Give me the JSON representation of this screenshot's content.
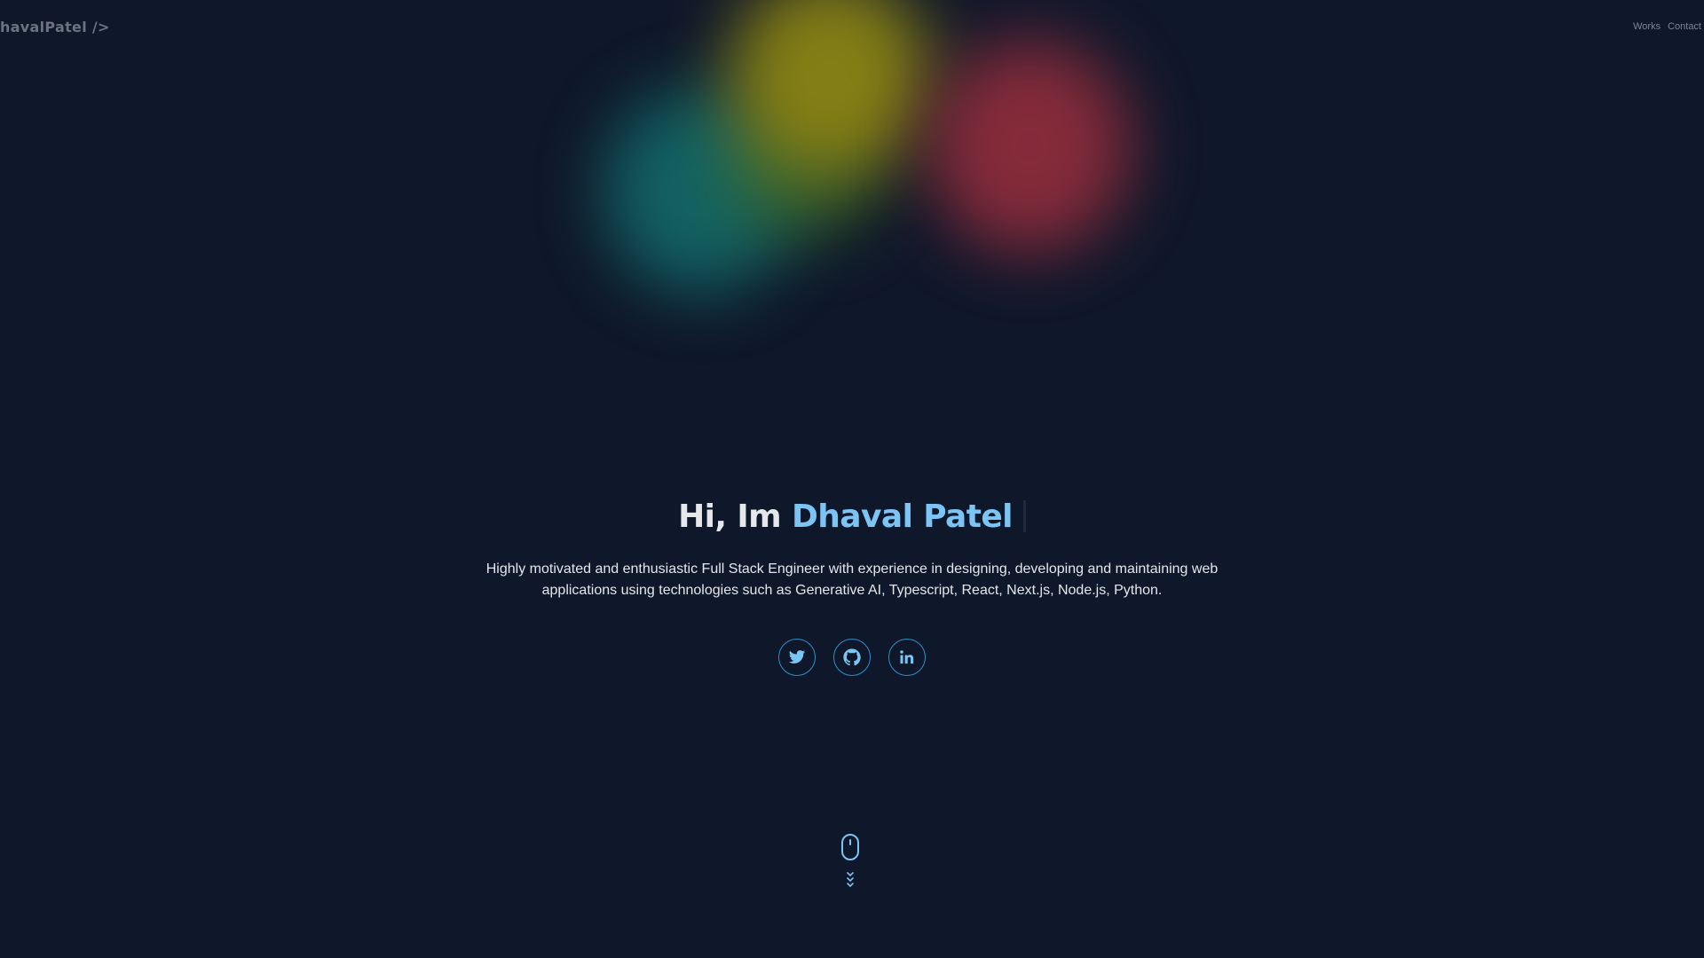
{
  "header": {
    "logo": "havalPatel />",
    "nav": [
      "Works",
      "Contact"
    ]
  },
  "hero": {
    "greeting": "Hi, Im",
    "name": "Dhaval Patel",
    "bio": "Highly motivated and enthusiastic Full Stack Engineer with experience in designing, developing and maintaining web applications using technologies such as Generative AI, Typescript, React, Next.js, Node.js, Python."
  },
  "socials": [
    {
      "icon": "twitter-icon"
    },
    {
      "icon": "github-icon"
    },
    {
      "icon": "linkedin-icon"
    }
  ],
  "scroll_indicator": {
    "icon": "mouse-scroll-icon"
  },
  "colors": {
    "background": "#0f172a",
    "accent": "#7cc4f4",
    "icon_stroke": "#2b90c8",
    "blob_yellow": "#8a8414",
    "blob_teal": "#136a6a",
    "blob_red": "#8c2c3b"
  }
}
